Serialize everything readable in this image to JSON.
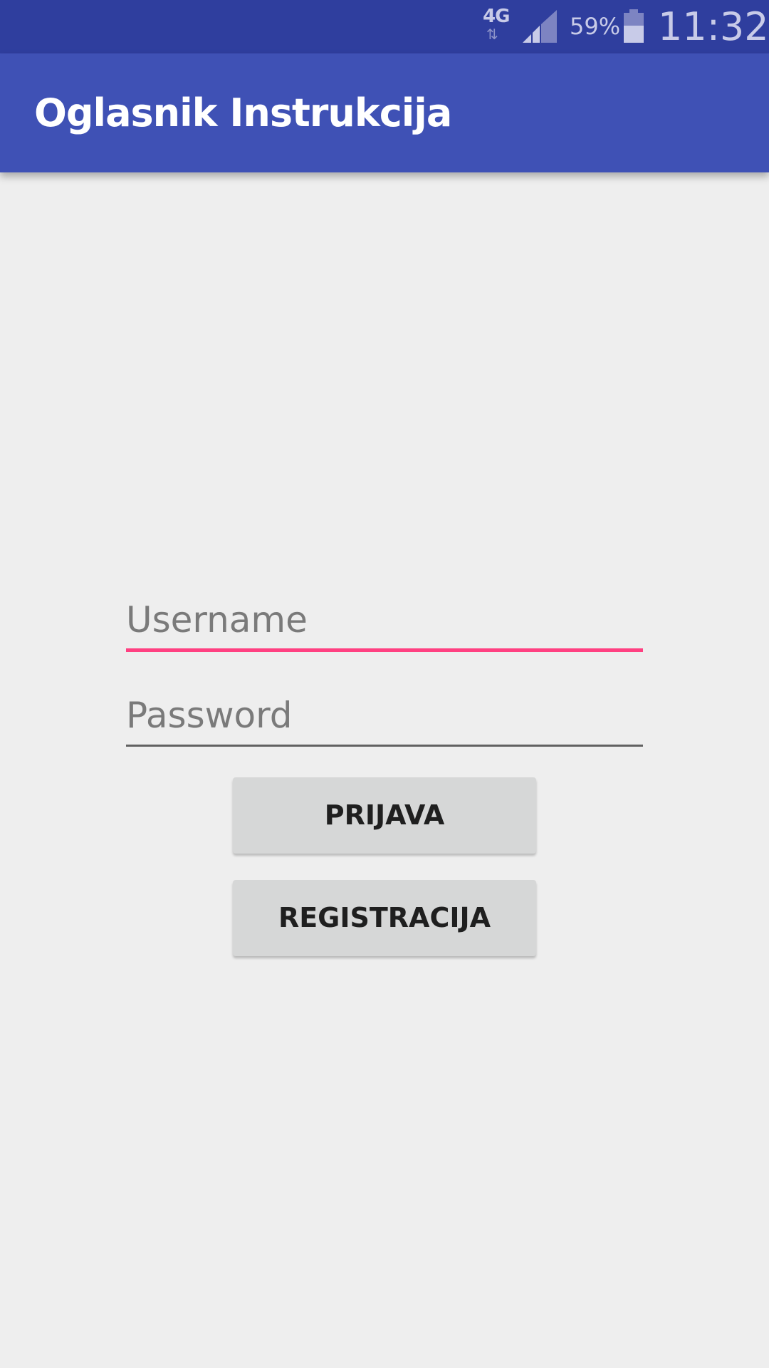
{
  "status_bar": {
    "network_type": "4G",
    "network_arrows": "⇅",
    "signal_icon": "signal-icon",
    "battery_percent": "59%",
    "battery_icon": "battery-icon",
    "time": "11:32"
  },
  "app_bar": {
    "title": "Oglasnik Instrukcija"
  },
  "login_form": {
    "username_placeholder": "Username",
    "password_placeholder": "Password",
    "login_label": "PRIJAVA",
    "register_label": "REGISTRACIJA"
  },
  "colors": {
    "status_bar": "#2f3e9e",
    "app_bar": "#3f51b5",
    "accent": "#ff4081",
    "background": "#eeeeee",
    "button": "#d6d7d7"
  }
}
